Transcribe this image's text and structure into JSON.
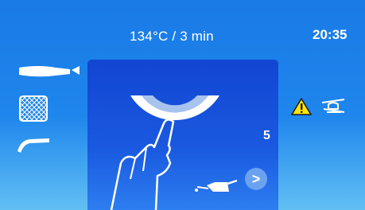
{
  "header": {
    "program": "134°C / 3 min",
    "time": "20:35"
  },
  "sidebar": {
    "tools": [
      {
        "icon": "straight-handpiece-icon",
        "selected": true
      },
      {
        "icon": "mesh-tray-icon",
        "selected": false
      },
      {
        "icon": "contra-angle-icon",
        "selected": false
      }
    ]
  },
  "panel": {
    "counter": "5",
    "next_label": ">",
    "icons": [
      "handpiece-bowl-icon",
      "tap-finger-icon",
      "oil-can-icon"
    ]
  },
  "status_icons": [
    "warning-icon",
    "oil-handpiece-icon"
  ],
  "colors": {
    "background_top": "#1a7ae6",
    "background_bottom": "#62bff4",
    "panel": "#1245d2",
    "warning_fill": "#ffe600"
  }
}
